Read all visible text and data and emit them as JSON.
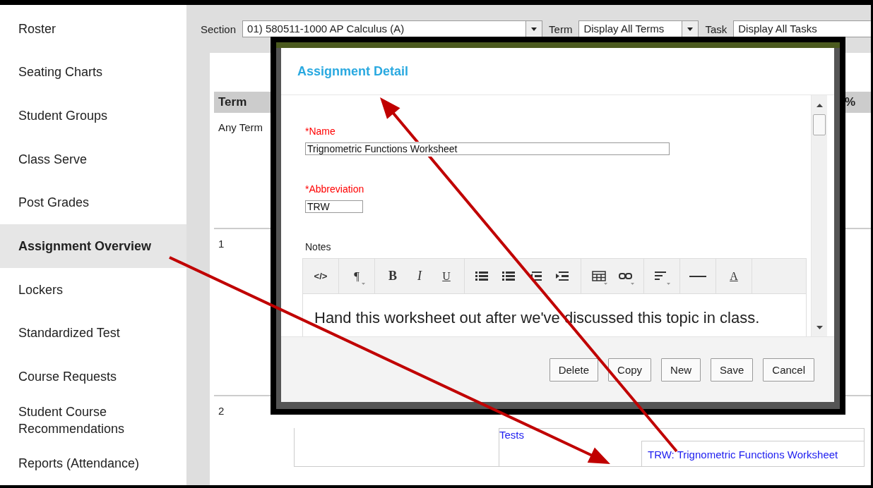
{
  "sidebar": {
    "items": [
      {
        "label": "Roster",
        "selected": false
      },
      {
        "label": "Seating Charts",
        "selected": false
      },
      {
        "label": "Student Groups",
        "selected": false
      },
      {
        "label": "Class Serve",
        "selected": false
      },
      {
        "label": "Post Grades",
        "selected": false
      },
      {
        "label": "Assignment Overview",
        "selected": true
      },
      {
        "label": "Lockers",
        "selected": false
      },
      {
        "label": "Standardized Test",
        "selected": false
      },
      {
        "label": "Course Requests",
        "selected": false
      },
      {
        "label": "Student Course Recommendations",
        "selected": false
      },
      {
        "label": "Reports (Attendance)",
        "selected": false
      }
    ]
  },
  "filters": [
    {
      "label": "Section",
      "value": "01) 580511-1000 AP Calculus (A)"
    },
    {
      "label": "Term",
      "value": "Display All Terms"
    },
    {
      "label": "Task",
      "value": "Display All Tasks"
    }
  ],
  "table": {
    "columns": [
      "Term",
      "%"
    ],
    "rows": [
      {
        "term": "Any Term"
      },
      {
        "term": "1"
      },
      {
        "term": "2",
        "category": "Tests",
        "assignment": "TRW: Trignometric Functions Worksheet"
      }
    ]
  },
  "dialog": {
    "title": "Assignment Detail",
    "fields": [
      {
        "label": "*Name",
        "required": true,
        "value": "Trignometric Functions Worksheet"
      },
      {
        "label": "*Abbreviation",
        "required": true,
        "value": "TRW"
      }
    ],
    "notes": {
      "label": "Notes",
      "toolbar": [
        [
          {
            "kind": "code",
            "label": "</>"
          }
        ],
        [
          {
            "kind": "paragraph",
            "label": "¶",
            "dropdown": true
          }
        ],
        [
          {
            "kind": "bold",
            "label": "B"
          },
          {
            "kind": "italic",
            "label": "I"
          },
          {
            "kind": "underline",
            "label": "U"
          }
        ],
        [
          {
            "kind": "bullets"
          },
          {
            "kind": "numbers"
          },
          {
            "kind": "outdent"
          },
          {
            "kind": "indent"
          }
        ],
        [
          {
            "kind": "table",
            "dropdown": true
          },
          {
            "kind": "link",
            "dropdown": true
          }
        ],
        [
          {
            "kind": "align",
            "dropdown": true
          }
        ],
        [
          {
            "kind": "rule"
          }
        ],
        [
          {
            "kind": "color",
            "label": "A"
          }
        ]
      ],
      "text": "Hand this worksheet out after we've discussed this topic in class."
    },
    "buttons": [
      "Delete",
      "Copy",
      "New",
      "Save",
      "Cancel"
    ]
  }
}
